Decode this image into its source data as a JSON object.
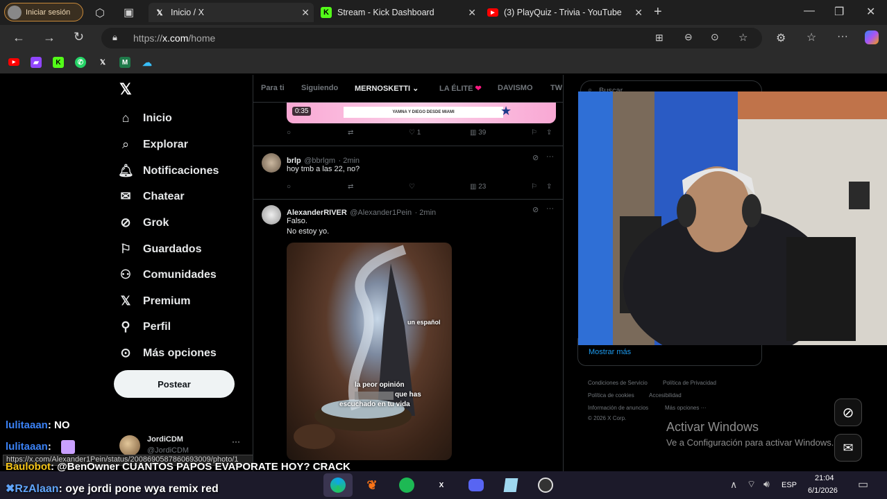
{
  "browser": {
    "profile_label": "Iniciar sesión",
    "tabs": [
      {
        "title": "Inicio / X",
        "icon": "x-logo-icon"
      },
      {
        "title": "Stream - Kick Dashboard",
        "icon": "kick-icon"
      },
      {
        "title": "(3) PlayQuiz - Trivia - YouTube",
        "icon": "youtube-icon"
      }
    ],
    "url_prefix": "https://",
    "url_domain": "x.com",
    "url_path": "/home"
  },
  "sidebar": {
    "items": [
      {
        "label": "Inicio",
        "icon": "home-icon"
      },
      {
        "label": "Explorar",
        "icon": "search-icon"
      },
      {
        "label": "Notificaciones",
        "icon": "bell-icon"
      },
      {
        "label": "Chatear",
        "icon": "mail-icon"
      },
      {
        "label": "Grok",
        "icon": "grok-icon"
      },
      {
        "label": "Guardados",
        "icon": "bookmark-icon"
      },
      {
        "label": "Comunidades",
        "icon": "people-icon"
      },
      {
        "label": "Premium",
        "icon": "x-logo-icon"
      },
      {
        "label": "Perfil",
        "icon": "person-icon"
      },
      {
        "label": "Más opciones",
        "icon": "more-circle-icon"
      }
    ],
    "post_label": "Postear",
    "account_name": "JordiCDM",
    "account_handle": "@JordiCDM",
    "status_url": "https://x.com/Alexander1Pein/status/2008690587860693009/photo/1"
  },
  "feed": {
    "tabs": [
      "Para ti",
      "Siguiendo",
      "MERNOSKETTI",
      "LA ÉLITE",
      "DAVISMO",
      "TW"
    ],
    "video_time": "0:35",
    "video_banner": "YAMNA Y DIEGO DESDE MIAMI",
    "tweet0_stats": {
      "likes": "1",
      "views": "39"
    },
    "tweet1": {
      "name": "brlp",
      "handle": "@bbrlgm",
      "time": "· 2min",
      "text": "hoy tmb a las 22, no?",
      "views": "23"
    },
    "tweet2": {
      "name": "AlexanderRIVER",
      "handle": "@Alexander1Pein",
      "time": "· 2min",
      "line1": "Falso.",
      "line2": "No estoy yo.",
      "meme_top": "un español",
      "meme_bottom1": "la peor opinión",
      "meme_bottom2": "que has",
      "meme_bottom3": "escuchado en tu vida"
    }
  },
  "right": {
    "search_placeholder": "Buscar",
    "show_more": "Mostrar más",
    "footer": [
      "Condiciones de Servicio",
      "Política de Privacidad",
      "Política de cookies",
      "Accesibilidad",
      "Información de anuncios",
      "Más opciones ···",
      "© 2026 X Corp."
    ],
    "activate_title": "Activar Windows",
    "activate_sub": "Ve a Configuración para activar Windows."
  },
  "chat": [
    {
      "user": "lulitaaan",
      "msg": ": NO",
      "color": "#3b82f6"
    },
    {
      "user": "lulitaaan",
      "msg": ":",
      "color": "#3b82f6"
    },
    {
      "user": "Baulobot",
      "msg": ": @BenOwner CUANTOS PAPOS EVAPORATE HOY? CRACK",
      "color": "#f5c518"
    },
    {
      "user": "RzAlaan",
      "msg": ": oye jordi pone wya remix red",
      "color": "#60a5fa"
    }
  ],
  "taskbar": {
    "lang": "ESP",
    "time": "21:04",
    "date": "6/1/2026"
  },
  "colors": {
    "x_accent": "#1d9bf0",
    "kick_green": "#53fc18",
    "youtube_red": "#ff0000",
    "taskbar": "#1c1a2a"
  }
}
